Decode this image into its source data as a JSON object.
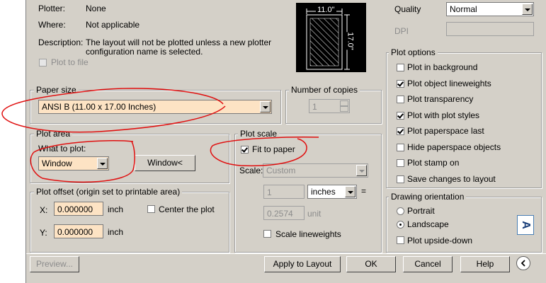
{
  "printer": {
    "plotter_label": "Plotter:",
    "plotter_value": "None",
    "where_label": "Where:",
    "where_value": "Not applicable",
    "description_label": "Description:",
    "description_line1": "The layout will not be plotted unless a new plotter",
    "description_line2": "configuration name is selected.",
    "plot_to_file": "Plot to file"
  },
  "preview": {
    "width_label": "11.0\"",
    "height_label": "17.0\""
  },
  "quality": {
    "quality_label": "Quality",
    "quality_value": "Normal",
    "dpi_label": "DPI",
    "dpi_value": ""
  },
  "paper_size": {
    "group_title": "Paper size",
    "value": "ANSI B (11.00 x 17.00 Inches)"
  },
  "copies": {
    "group_title": "Number of copies",
    "value": "1"
  },
  "plot_area": {
    "group_title": "Plot area",
    "what_label": "What to plot:",
    "value": "Window",
    "window_button": "Window<"
  },
  "plot_scale": {
    "group_title": "Plot scale",
    "fit_to_paper": "Fit to paper",
    "fit_to_paper_checked": true,
    "scale_label": "Scale:",
    "scale_value": "Custom",
    "num_value": "1",
    "unit_value": "inches",
    "equals": "=",
    "den_value": "0.2574",
    "den_unit": "unit",
    "scale_lineweights": "Scale lineweights"
  },
  "plot_offset": {
    "group_title": "Plot offset (origin set to printable area)",
    "x_label": "X:",
    "x_value": "0.000000",
    "x_unit": "inch",
    "y_label": "Y:",
    "y_value": "0.000000",
    "y_unit": "inch",
    "center": "Center the plot"
  },
  "plot_options": {
    "group_title": "Plot options",
    "items": [
      {
        "label": "Plot in background",
        "checked": false
      },
      {
        "label": "Plot object lineweights",
        "checked": true
      },
      {
        "label": "Plot transparency",
        "checked": false
      },
      {
        "label": "Plot with plot styles",
        "checked": true
      },
      {
        "label": "Plot paperspace last",
        "checked": true
      },
      {
        "label": "Hide paperspace objects",
        "checked": false
      },
      {
        "label": "Plot stamp on",
        "checked": false
      },
      {
        "label": "Save changes to layout",
        "checked": false
      }
    ]
  },
  "orientation": {
    "group_title": "Drawing orientation",
    "portrait": "Portrait",
    "landscape": "Landscape",
    "upside_down": "Plot upside-down",
    "selected": "landscape",
    "icon_letter": "A"
  },
  "footer": {
    "preview": "Preview...",
    "apply": "Apply to Layout",
    "ok": "OK",
    "cancel": "Cancel",
    "help": "Help"
  }
}
